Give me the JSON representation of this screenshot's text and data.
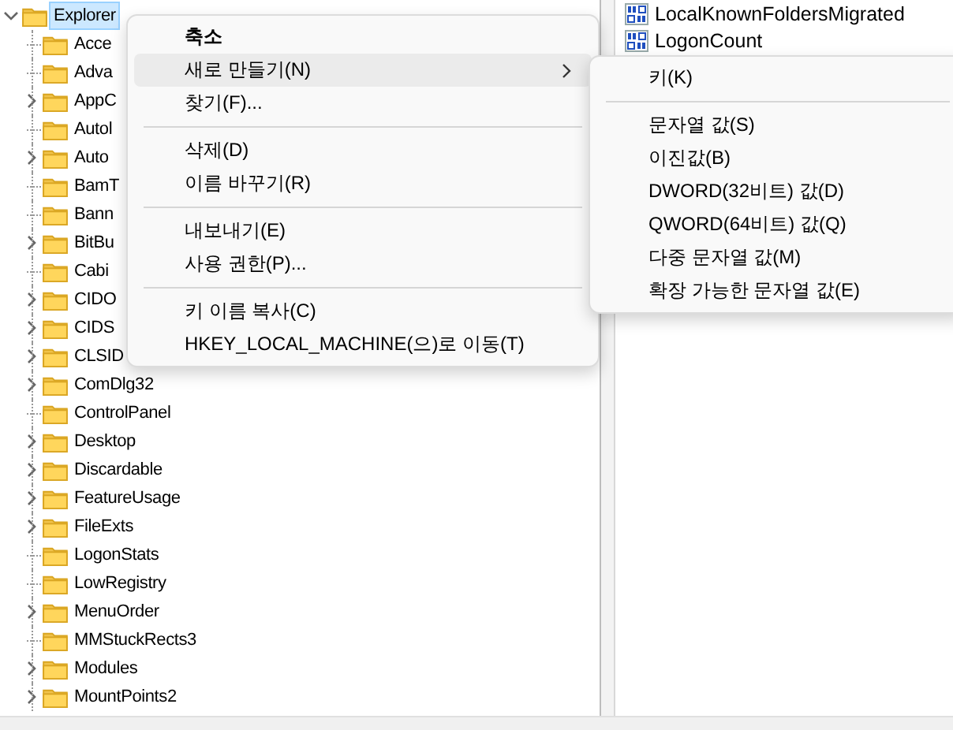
{
  "tree": {
    "label": "Explorer",
    "expanded": true,
    "selected": true,
    "children": [
      {
        "label": "Acce",
        "has_children": false
      },
      {
        "label": "Adva",
        "has_children": false
      },
      {
        "label": "AppC",
        "has_children": true
      },
      {
        "label": "Autol",
        "has_children": false
      },
      {
        "label": "Auto",
        "has_children": true
      },
      {
        "label": "BamT",
        "has_children": false
      },
      {
        "label": "Bann",
        "has_children": false
      },
      {
        "label": "BitBu",
        "has_children": true
      },
      {
        "label": "Cabi",
        "has_children": false
      },
      {
        "label": "CIDO",
        "has_children": true
      },
      {
        "label": "CIDS",
        "has_children": true
      },
      {
        "label": "CLSID",
        "has_children": true
      },
      {
        "label": "ComDlg32",
        "has_children": true
      },
      {
        "label": "ControlPanel",
        "has_children": false
      },
      {
        "label": "Desktop",
        "has_children": true
      },
      {
        "label": "Discardable",
        "has_children": true
      },
      {
        "label": "FeatureUsage",
        "has_children": true
      },
      {
        "label": "FileExts",
        "has_children": true
      },
      {
        "label": "LogonStats",
        "has_children": false
      },
      {
        "label": "LowRegistry",
        "has_children": false
      },
      {
        "label": "MenuOrder",
        "has_children": true
      },
      {
        "label": "MMStuckRects3",
        "has_children": false
      },
      {
        "label": "Modules",
        "has_children": true
      },
      {
        "label": "MountPoints2",
        "has_children": true
      }
    ]
  },
  "values": [
    {
      "name": "LocalKnownFoldersMigrated",
      "kind": "binary"
    },
    {
      "name": "LogonCount",
      "kind": "binary"
    }
  ],
  "context_menu": {
    "groups": [
      [
        {
          "label": "축소",
          "default": true,
          "selected": false,
          "submenu": false
        },
        {
          "label": "새로 만들기(N)",
          "default": false,
          "selected": true,
          "submenu": true
        },
        {
          "label": "찾기(F)...",
          "default": false,
          "selected": false,
          "submenu": false
        }
      ],
      [
        {
          "label": "삭제(D)",
          "default": false,
          "selected": false,
          "submenu": false
        },
        {
          "label": "이름 바꾸기(R)",
          "default": false,
          "selected": false,
          "submenu": false
        }
      ],
      [
        {
          "label": "내보내기(E)",
          "default": false,
          "selected": false,
          "submenu": false
        },
        {
          "label": "사용 권한(P)...",
          "default": false,
          "selected": false,
          "submenu": false
        }
      ],
      [
        {
          "label": "키 이름 복사(C)",
          "default": false,
          "selected": false,
          "submenu": false
        },
        {
          "label": "HKEY_LOCAL_MACHINE(으)로 이동(T)",
          "default": false,
          "selected": false,
          "submenu": false
        }
      ]
    ]
  },
  "submenu": {
    "groups": [
      [
        {
          "label": "키(K)",
          "selected": false
        }
      ],
      [
        {
          "label": "문자열 값(S)",
          "selected": false
        },
        {
          "label": "이진값(B)",
          "selected": false
        },
        {
          "label": "DWORD(32비트) 값(D)",
          "selected": false
        },
        {
          "label": "QWORD(64비트) 값(Q)",
          "selected": false
        },
        {
          "label": "다중 문자열 값(M)",
          "selected": false
        },
        {
          "label": "확장 가능한 문자열 값(E)",
          "selected": false
        }
      ]
    ]
  }
}
